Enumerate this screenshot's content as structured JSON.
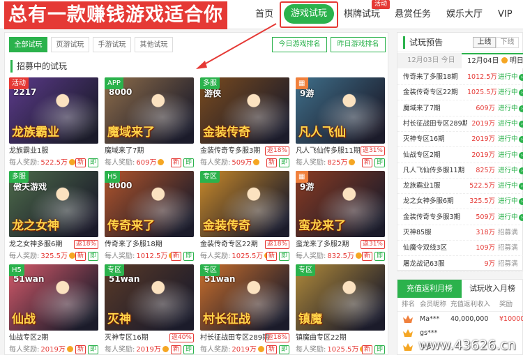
{
  "header": {
    "slogan": "总有一款赚钱游戏适合你",
    "nav": [
      "首页",
      "游戏试玩",
      "棋牌试玩",
      "悬赏任务",
      "娱乐大厅",
      "VIP"
    ],
    "badge": "活动"
  },
  "filter_tabs": [
    "全部试玩",
    "页游试玩",
    "手游试玩",
    "其他试玩"
  ],
  "rank_buttons": [
    "今日游戏排名",
    "昨日游戏排名"
  ],
  "section_title": "招募中的试玩",
  "reward_label": "每人奖励:",
  "new_label": "新",
  "claim_label": "即",
  "cards": [
    {
      "tag": "活动",
      "tag_color": "#e53935",
      "logo": "2217",
      "title": "龙族霸业",
      "name": "龙族霸业1服",
      "rate": "",
      "reward": "522.5万",
      "bg": "#5b3a8a"
    },
    {
      "tag": "APP",
      "tag_color": "#2bb24c",
      "logo": "8000",
      "title": "魔域来了",
      "name": "魔域来了7期",
      "rate": "",
      "reward": "609万",
      "bg": "#8e6d4a"
    },
    {
      "tag": "多服",
      "tag_color": "#2bb24c",
      "logo": "游侠",
      "title": "金装传奇",
      "name": "金装传奇专多服3期",
      "rate": "返18%",
      "reward": "509万",
      "bg": "#7a4b1e"
    },
    {
      "tag": "",
      "tag_color": "#f0803c",
      "logo": "9游",
      "title": "凡人飞仙",
      "name": "凡人飞仙传多服11期",
      "rate": "返31%",
      "reward": "825万",
      "bg": "#3f6f8a"
    },
    {
      "tag": "多服",
      "tag_color": "#2bb24c",
      "logo": "傲天游戏",
      "title": "龙之女神",
      "name": "龙之女神多服6期",
      "rate": "返18%",
      "reward": "325.5万",
      "bg": "#4d6b4a"
    },
    {
      "tag": "H5",
      "tag_color": "#2bb24c",
      "logo": "8000",
      "title": "传奇来了",
      "name": "传奇来了多服18期",
      "rate": "",
      "reward": "1012.5万",
      "bg": "#b2552b"
    },
    {
      "tag": "专区",
      "tag_color": "#2bb24c",
      "logo": "",
      "title": "金装传奇",
      "name": "金装传奇专区22期",
      "rate": "返18%",
      "reward": "1025.5万",
      "bg": "#c98a2a"
    },
    {
      "tag": "",
      "tag_color": "#f0803c",
      "logo": "9游",
      "title": "蛮龙来了",
      "name": "蛮龙来了多服2期",
      "rate": "返31%",
      "reward": "832.5万",
      "bg": "#8a3b22"
    },
    {
      "tag": "H5",
      "tag_color": "#2bb24c",
      "logo": "51wan",
      "title": "仙战",
      "name": "仙战专区2期",
      "rate": "",
      "reward": "2019万",
      "bg": "#d45a6a"
    },
    {
      "tag": "专区",
      "tag_color": "#2bb24c",
      "logo": "51wan",
      "title": "灭神",
      "name": "灭神专区16期",
      "rate": "返40%",
      "reward": "2019万",
      "bg": "#5a3a28"
    },
    {
      "tag": "专区",
      "tag_color": "#2bb24c",
      "logo": "51wan",
      "title": "村长征战",
      "name": "村长征战田专区289期",
      "rate": "返18%",
      "reward": "2019万",
      "bg": "#c96f2d"
    },
    {
      "tag": "专区",
      "tag_color": "#2bb24c",
      "logo": "",
      "title": "镇魔",
      "name": "镇魔曲专区22期",
      "rate": "",
      "reward": "1025.5万",
      "bg": "#b08a3a"
    }
  ],
  "preview": {
    "title": "试玩预告",
    "online": "上线",
    "offline": "下线",
    "dates": [
      {
        "label": "12月03日",
        "sub": "今日"
      },
      {
        "label": "12月04日",
        "sub": "明日"
      }
    ],
    "rows": [
      {
        "game": "传奇来了多服18期",
        "amount": "1012.5万",
        "status": "进行中",
        "on": true
      },
      {
        "game": "金装传奇专区22期",
        "amount": "1025.5万",
        "status": "进行中",
        "on": true
      },
      {
        "game": "魔域来了7期",
        "amount": "609万",
        "status": "进行中",
        "on": true
      },
      {
        "game": "村长征战田专区289期",
        "amount": "2019万",
        "status": "进行中",
        "on": true
      },
      {
        "game": "灭神专区16期",
        "amount": "2019万",
        "status": "进行中",
        "on": true
      },
      {
        "game": "仙战专区2期",
        "amount": "2019万",
        "status": "进行中",
        "on": true
      },
      {
        "game": "凡人飞仙传多服11期",
        "amount": "825万",
        "status": "进行中",
        "on": true
      },
      {
        "game": "龙族霸业1服",
        "amount": "522.5万",
        "status": "进行中",
        "on": true
      },
      {
        "game": "龙之女神多服6期",
        "amount": "325.5万",
        "status": "进行中",
        "on": true
      },
      {
        "game": "金装传奇专多服3期",
        "amount": "509万",
        "status": "进行中",
        "on": true
      },
      {
        "game": "灭神85服",
        "amount": "318万",
        "status": "招募满",
        "on": false
      },
      {
        "game": "仙魔令双线3区",
        "amount": "109万",
        "status": "招募满",
        "on": false
      },
      {
        "game": "屠龙战记63服",
        "amount": "9万",
        "status": "招募满",
        "on": false
      }
    ]
  },
  "monthly": {
    "tab_active": "充值返利月榜",
    "tab_other": "试玩收入月榜",
    "headers": [
      "排名",
      "会员昵称",
      "充值返利收入",
      "奖励"
    ],
    "rows": [
      {
        "nick": "Ma***",
        "income": "40,000,000",
        "reward": "¥10000"
      },
      {
        "nick": "gs***",
        "income": "",
        "reward": ""
      },
      {
        "nick": "步步***",
        "income": "",
        "reward": ""
      }
    ]
  },
  "watermark": "www.43626.cn",
  "colors": {
    "accent": "#2bb24c",
    "red": "#e53935"
  }
}
